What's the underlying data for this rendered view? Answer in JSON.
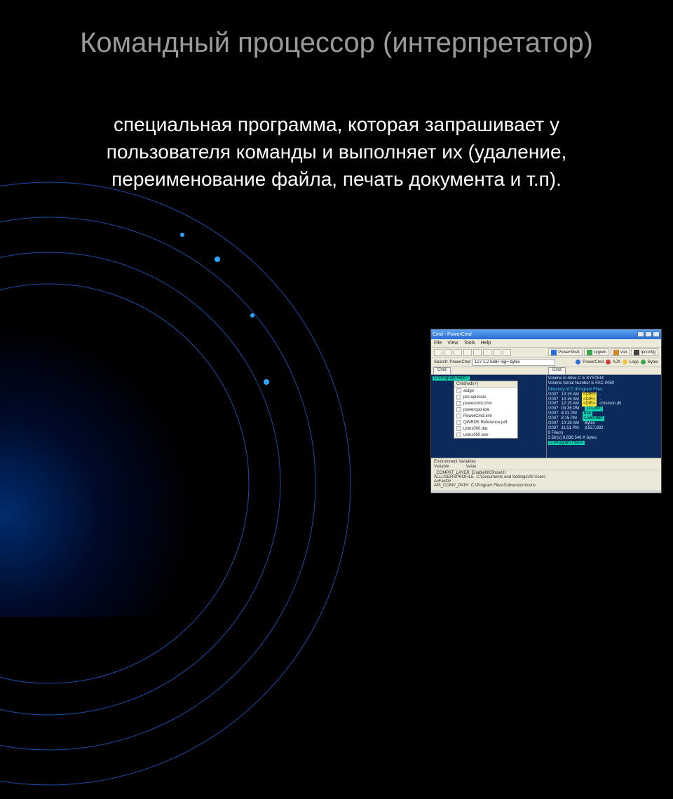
{
  "slide": {
    "title": "Командный процессор (интерпретатор)",
    "body": "специальная программа, которая запрашивает у пользователя команды и выполняет их (удаление, переименование файла, печать документа и т.п)."
  },
  "shot": {
    "window_title": "Cmd - PowerCmd",
    "menu": [
      "File",
      "View",
      "Tools",
      "Help"
    ],
    "toolbar_right": [
      "PowerShell",
      "cygwin",
      "vsb",
      "ipconfig"
    ],
    "search_label": "Search: PowerCmd",
    "search_value": "127.1.2 Add+ log+ bytes",
    "search_buttons": {
      "a": "PowerCmd",
      "b": "AJX",
      "c": "Logs",
      "d": "Bytes"
    },
    "tabs": [
      "Cmd",
      "Cmd"
    ],
    "left_pane": {
      "prompt": "C:\\Program Files>"
    },
    "dropdown": {
      "header": "Cmd(wds+)",
      "items": [
        "autgo",
        "pro.xpressiv",
        "powercmd.chm",
        "powercpd.exe",
        "PowerCmd.xml",
        "QWRDE Reference.pdf",
        "unins000.dat",
        "unins000.exe"
      ]
    },
    "right_pane": {
      "vol": "Volume in drive C is SYSTEM",
      "serial": "Volume Serial Number is FAC-0050",
      "dir_of": "Directory of C:\\Program Files",
      "rows": [
        {
          "date": "/2007",
          "time": "10:15 AM",
          "attr": "<DIR>",
          "name": "."
        },
        {
          "date": "/2007",
          "time": "10:15 AM",
          "attr": "<DIR>",
          "name": ".."
        },
        {
          "date": "/2007",
          "time": "12:15 AM",
          "attr": "<DIR>",
          "name": "common.dll"
        },
        {
          "date": "/2007",
          "time": "03:36 PM",
          "attr": "",
          "name": "121,800",
          "sel": true
        },
        {
          "date": "/2007",
          "time": " 8:31 PM",
          "attr": "",
          "name": "838",
          "sel": true
        },
        {
          "date": "/2007",
          "time": " 8:15 PM",
          "attr": "",
          "name": "2,563,960",
          "sel": true
        },
        {
          "date": "/2007",
          "time": "10:18 AM",
          "attr": "",
          "name": "Bytes"
        },
        {
          "date": "/2007",
          "time": "11:51 PM",
          "attr": "",
          "name": "3,557,892"
        }
      ],
      "summary1": "9 File(s)",
      "summary2": "3 Dir(s)  9,836,546 K bytes",
      "prompt2": "C:\\Program Files>"
    },
    "footer": {
      "heading": "Environment Variables",
      "col1": "Variable",
      "col2": "Value",
      "rows": [
        {
          "k": "_COMPAT_LAYER",
          "v": "EnableNXShowUI"
        },
        {
          "k": "ALLUSERSPROFILE",
          "v": "C:\\Documents and Settings\\All Users"
        },
        {
          "k": "AvFaxDir",
          "v": ""
        },
        {
          "k": "API_COMV_PATH",
          "v": "C:\\Program Files\\Subversion\\iconv"
        }
      ]
    }
  }
}
